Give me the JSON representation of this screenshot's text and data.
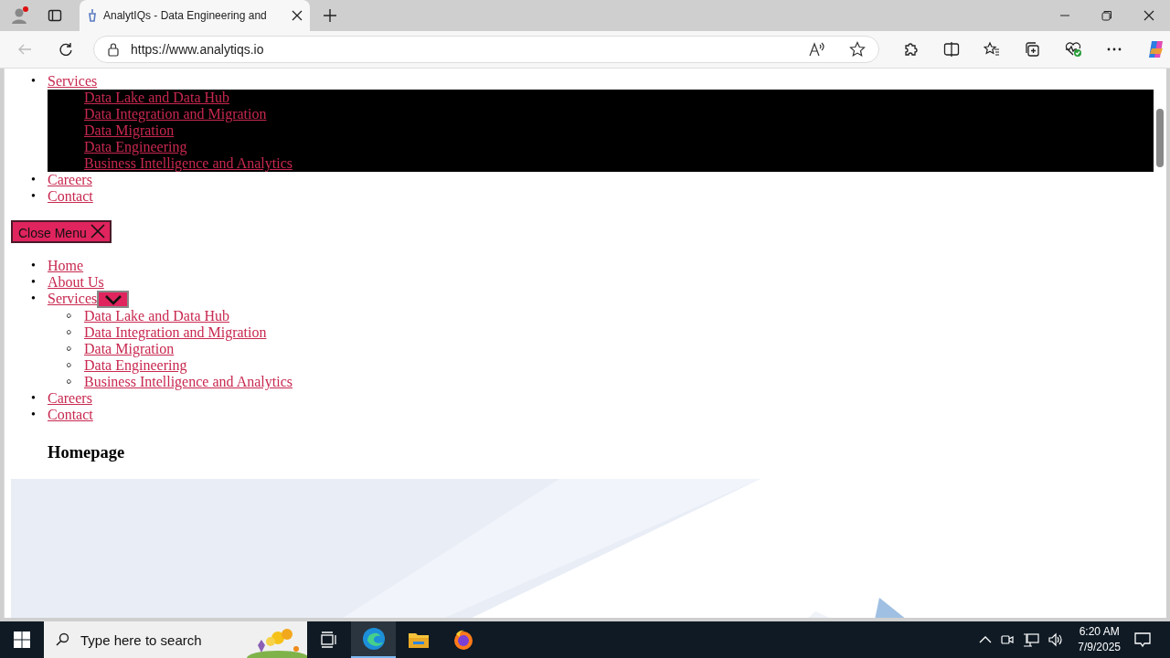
{
  "browser": {
    "tab_title": "AnalytIQs - Data Engineering and",
    "url": "https://www.analytiqs.io"
  },
  "open_menu": {
    "items": [
      {
        "marker": "•",
        "label": "Services",
        "children": [
          "Data Lake and Data Hub",
          "Data Integration and Migration",
          "Data Migration",
          "Data Engineering",
          "Business Intelligence and Analytics"
        ]
      },
      {
        "marker": "•",
        "label": "Careers"
      },
      {
        "marker": "•",
        "label": "Contact"
      }
    ]
  },
  "close_menu_button": "Close Menu",
  "nav": {
    "items": [
      {
        "marker": "•",
        "label": "Home"
      },
      {
        "marker": "•",
        "label": "About Us"
      },
      {
        "marker": "•",
        "label": "Services",
        "expanded": true,
        "children": [
          {
            "marker": "◦",
            "label": "Data Lake and Data Hub"
          },
          {
            "marker": "◦",
            "label": "Data Integration and Migration"
          },
          {
            "marker": "◦",
            "label": "Data Migration"
          },
          {
            "marker": "◦",
            "label": "Data Engineering"
          },
          {
            "marker": "◦",
            "label": "Business Intelligence and Analytics"
          }
        ]
      },
      {
        "marker": "•",
        "label": "Careers"
      },
      {
        "marker": "•",
        "label": "Contact"
      }
    ]
  },
  "heading": "Homepage",
  "taskbar": {
    "search_placeholder": "Type here to search",
    "time": "6:20 AM",
    "date": "7/9/2025"
  }
}
